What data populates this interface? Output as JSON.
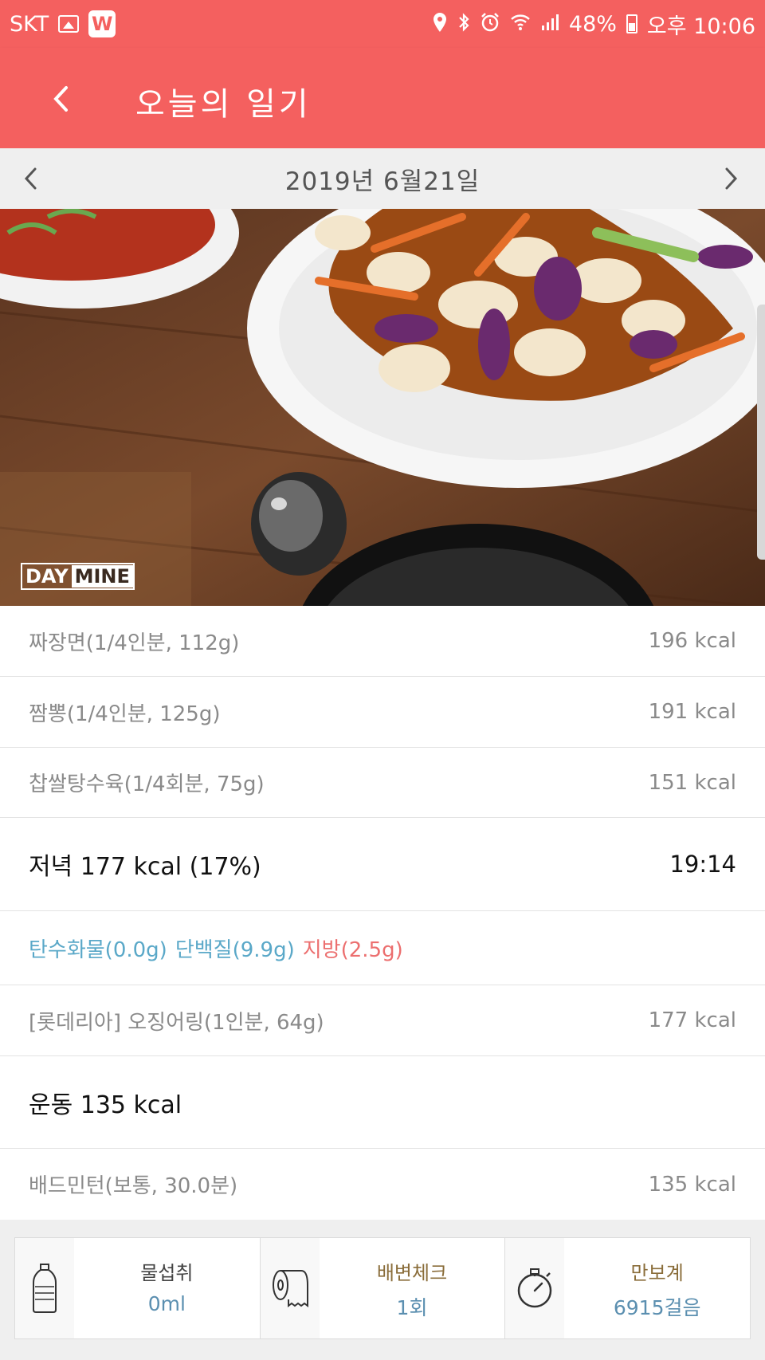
{
  "status_bar": {
    "carrier": "SKT",
    "app_badge": "W",
    "battery": "48%",
    "time": "오후 10:06"
  },
  "header": {
    "title": "오늘의 일기"
  },
  "date_bar": {
    "date": "2019년 6월21일"
  },
  "photo": {
    "watermark_a": "DAY",
    "watermark_b": "MINE"
  },
  "foods_dinner_previous": [
    {
      "name": "짜장면(1/4인분, 112g)",
      "kcal": "196 kcal"
    },
    {
      "name": "짬뽕(1/4인분, 125g)",
      "kcal": "191 kcal"
    },
    {
      "name": "찹쌀탕수육(1/4회분, 75g)",
      "kcal": "151 kcal"
    }
  ],
  "dinner_section": {
    "title": "저녁 177 kcal (17%)",
    "time": "19:14",
    "nutrients": {
      "carb": "탄수화물(0.0g)",
      "protein": "단백질(9.9g)",
      "fat": "지방(2.5g)",
      "carb_color": "#5aa8c8",
      "protein_color": "#5aa8c8",
      "fat_color": "#ec6f6f"
    },
    "item": {
      "name": "[롯데리아] 오징어링(1인분, 64g)",
      "kcal": "177 kcal"
    }
  },
  "exercise_section": {
    "title": "운동 135 kcal",
    "item": {
      "name": "배드민턴(보통, 30.0분)",
      "kcal": "135 kcal"
    }
  },
  "bottom_cards": [
    {
      "icon": "water-bottle-icon",
      "title": "물섭취",
      "value": "0ml"
    },
    {
      "icon": "toilet-paper-icon",
      "title": "배변체크",
      "value": "1회"
    },
    {
      "icon": "stopwatch-icon",
      "title": "만보계",
      "value": "6915걸음"
    }
  ],
  "colors": {
    "accent": "#f4605f",
    "datebar_bg": "#efefef"
  }
}
